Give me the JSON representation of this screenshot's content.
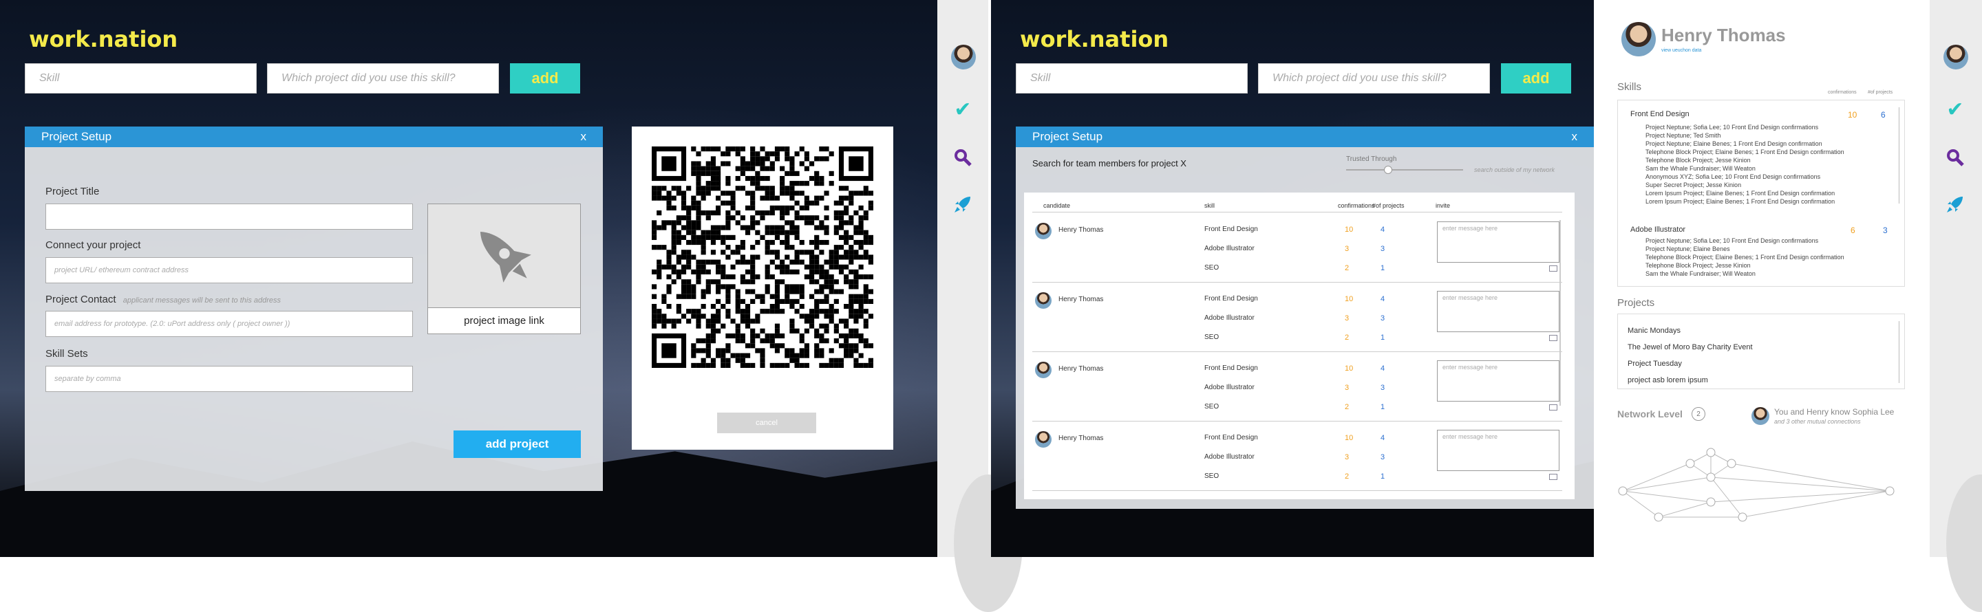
{
  "left": {
    "logo": "work.nation",
    "skill_placeholder": "Skill",
    "project_placeholder": "Which project did you use this skill?",
    "add_label": "add",
    "panel": {
      "title": "Project Setup",
      "close": "x",
      "title_label": "Project Title",
      "connect_label": "Connect your project",
      "connect_placeholder": "project URL/ ethereum contract address",
      "contact_label": "Project Contact",
      "contact_hint": "applicant messages will be sent to this address",
      "contact_placeholder": "email address for prototype. (2.0: uPort address only ( project owner ))",
      "skills_label": "Skill Sets",
      "skills_placeholder": "separate by comma",
      "image_link": "project image link",
      "add_project": "add project"
    },
    "qr": {
      "cancel": "cancel"
    }
  },
  "right": {
    "logo": "work.nation",
    "skill_placeholder": "Skill",
    "project_placeholder": "Which project did you use this skill?",
    "add_label": "add",
    "panel": {
      "title": "Project Setup",
      "close": "x",
      "search_title": "Search for team members for project X",
      "trusted": "Trusted Through",
      "outside": "search outside of my network",
      "cols": {
        "candidate": "candidate",
        "skill": "skill",
        "confirmations": "confirmations",
        "projects": "#of projects",
        "invite": "invite"
      },
      "msg_placeholder": "enter message here",
      "rows": [
        {
          "name": "Henry Thomas",
          "skills": [
            {
              "s": "Front End Design",
              "c": "10",
              "p": "4"
            },
            {
              "s": "Adobe Illustrator",
              "c": "3",
              "p": "3"
            },
            {
              "s": "SEO",
              "c": "2",
              "p": "1"
            }
          ]
        },
        {
          "name": "Henry Thomas",
          "skills": [
            {
              "s": "Front End Design",
              "c": "10",
              "p": "4"
            },
            {
              "s": "Adobe Illustrator",
              "c": "3",
              "p": "3"
            },
            {
              "s": "SEO",
              "c": "2",
              "p": "1"
            }
          ]
        },
        {
          "name": "Henry Thomas",
          "skills": [
            {
              "s": "Front End Design",
              "c": "10",
              "p": "4"
            },
            {
              "s": "Adobe Illustrator",
              "c": "3",
              "p": "3"
            },
            {
              "s": "SEO",
              "c": "2",
              "p": "1"
            }
          ]
        },
        {
          "name": "Henry Thomas",
          "skills": [
            {
              "s": "Front End Design",
              "c": "10",
              "p": "4"
            },
            {
              "s": "Adobe Illustrator",
              "c": "3",
              "p": "3"
            },
            {
              "s": "SEO",
              "c": "2",
              "p": "1"
            }
          ]
        }
      ]
    }
  },
  "profile": {
    "name": "Henry Thomas",
    "sub": "view ueuchon data",
    "skills_title": "Skills",
    "col_confirm": "confirmations",
    "col_projects": "#of projects",
    "skill1": {
      "name": "Front End Design",
      "c": "10",
      "p": "6",
      "lines": [
        "Project Neptune; Sofia Lee; 10 Front End Design confirmations",
        "Project Neptune; Ted Smith",
        "Project Neptune; Elaine Benes; 1 Front End Design confirmation",
        "Telephone Block Project; Elaine Benes; 1 Front End Design confirmation",
        "Telephone Block Project; Jesse Kinion",
        "Sam the Whale Fundraiser; Will Weaton",
        "Anonymous XYZ; Sofia Lee; 10 Front End Design confirmations",
        "Super Secret Project; Jesse Kinion",
        "Lorem Ipsum Project; Elaine Benes; 1 Front End Design confirmation",
        "Lorem Ipsum Project; Elaine Benes; 1 Front End Design confirmation"
      ]
    },
    "skill2": {
      "name": "Adobe Illustrator",
      "c": "6",
      "p": "3",
      "lines": [
        "Project Neptune; Sofia Lee; 10 Front End Design confirmations",
        "Project Neptune; Elaine Benes",
        "Telephone Block Project; Elaine Benes; 1 Front End Design confirmation",
        "Telephone Block Project; Jesse Kinion",
        "Sam the Whale Fundraiser; Will Weaton"
      ]
    },
    "projects_title": "Projects",
    "projects": [
      "Manic Mondays",
      "The Jewel of Moro Bay Charity Event",
      "Project Tuesday",
      "project asb lorem ipsum"
    ],
    "network_title": "Network Level",
    "network_level": "2",
    "mutual": "You and Henry know Sophia Lee",
    "mutual_sub": "and 3 other mutual connections"
  }
}
